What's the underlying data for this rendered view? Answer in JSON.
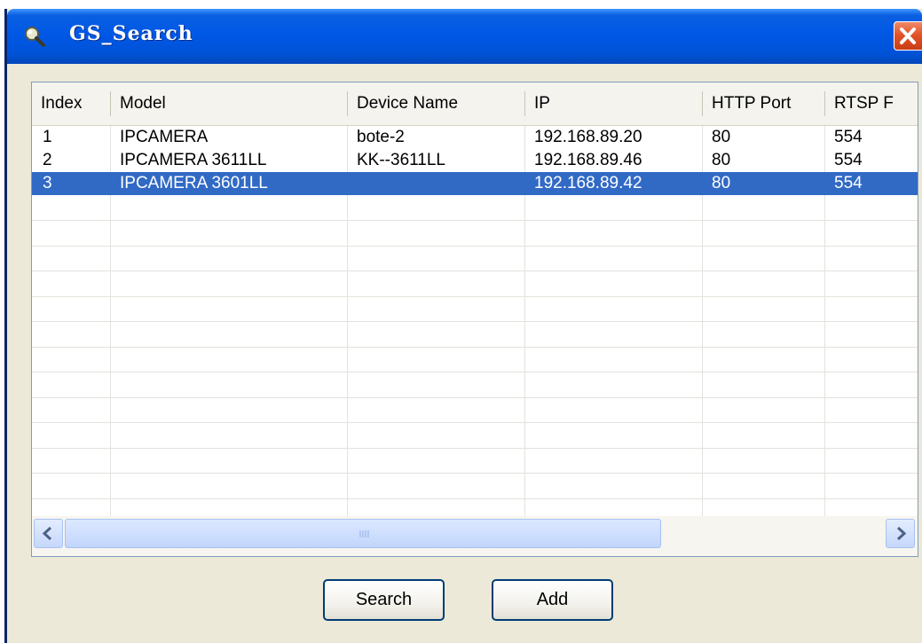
{
  "window": {
    "title": "GS_Search",
    "title_icon": "search-magnifier-icon",
    "close_icon": "close-icon"
  },
  "list": {
    "columns": [
      "Index",
      "Model",
      "Device Name",
      "IP",
      "HTTP Port",
      "RTSP F"
    ],
    "rows": [
      {
        "index": "1",
        "model": "IPCAMERA",
        "device_name": "bote-2",
        "ip": "192.168.89.20",
        "http_port": "80",
        "rtsp_port": "554",
        "selected": false
      },
      {
        "index": "2",
        "model": "IPCAMERA 3611LL",
        "device_name": "KK--3611LL",
        "ip": "192.168.89.46",
        "http_port": "80",
        "rtsp_port": "554",
        "selected": false
      },
      {
        "index": "3",
        "model": "IPCAMERA 3601LL",
        "device_name": "",
        "ip": "192.168.89.42",
        "http_port": "80",
        "rtsp_port": "554",
        "selected": true
      }
    ],
    "selection_color": "#316ac5"
  },
  "scrollbar": {
    "left_icon": "chevron-left-icon",
    "right_icon": "chevron-right-icon"
  },
  "buttons": {
    "search_label": "Search",
    "add_label": "Add"
  }
}
